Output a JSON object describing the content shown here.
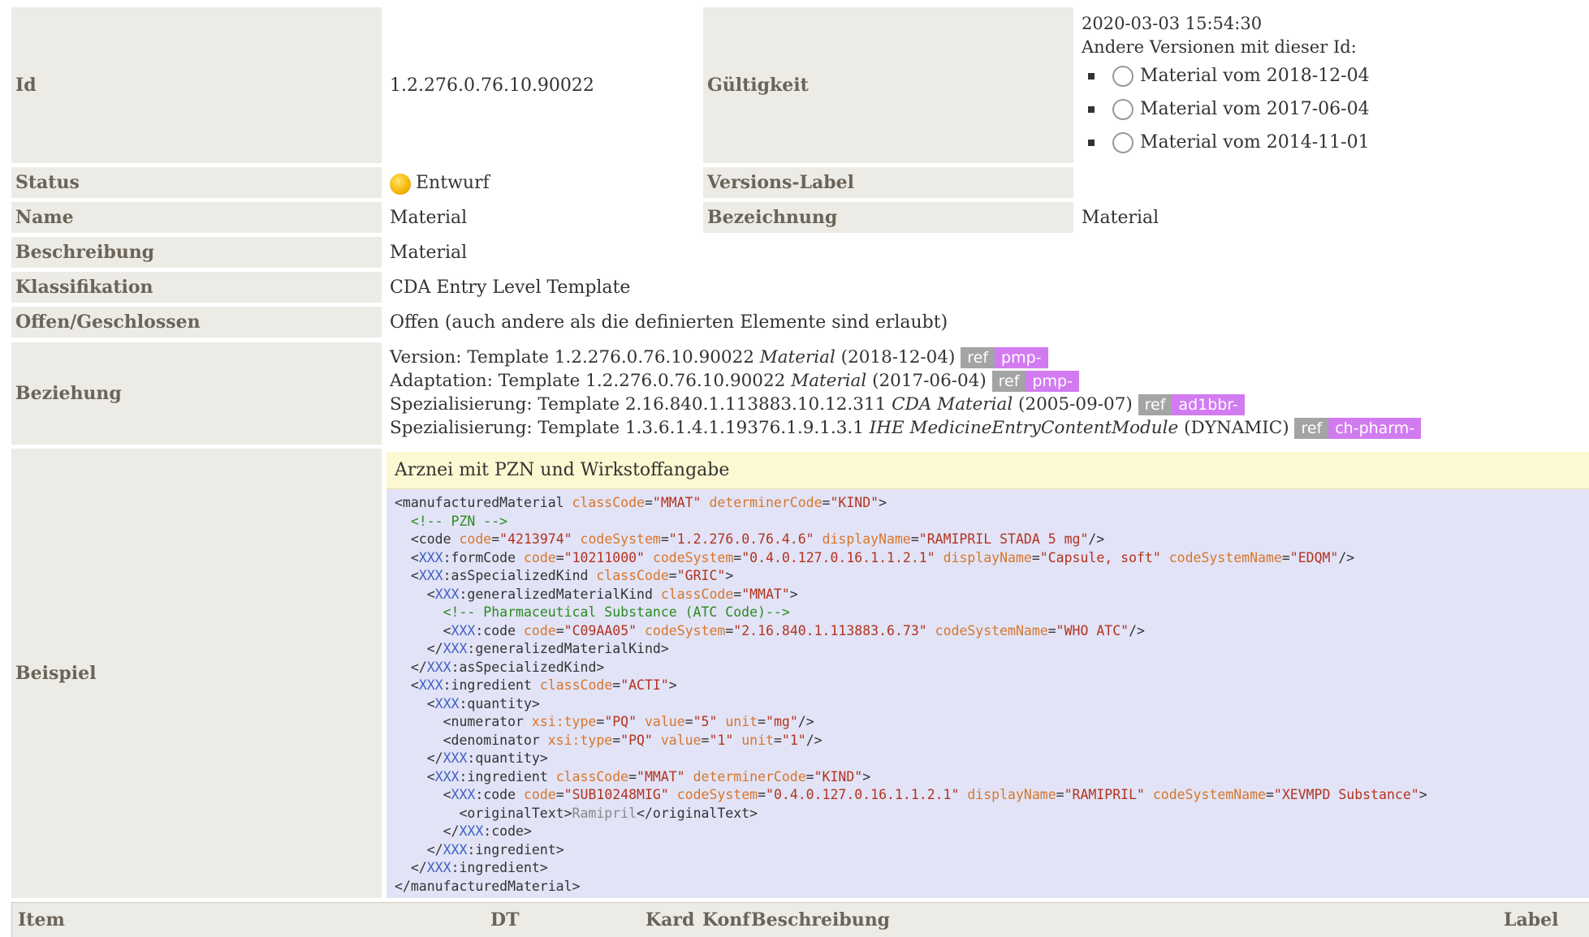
{
  "rows": {
    "id": {
      "label": "Id",
      "value": "1.2.276.0.76.10.90022"
    },
    "validity": {
      "label": "Gültigkeit",
      "date": "2020-03-03 15:54:30",
      "other_versions_label": "Andere Versionen mit dieser Id:",
      "versions": [
        "Material vom 2018-12-04",
        "Material vom 2017-06-04",
        "Material vom 2014-11-01"
      ]
    },
    "status": {
      "label": "Status",
      "value": "Entwurf"
    },
    "version_label": {
      "label": "Versions-Label",
      "value": ""
    },
    "name": {
      "label": "Name",
      "value": "Material"
    },
    "designation": {
      "label": "Bezeichnung",
      "value": "Material"
    },
    "description": {
      "label": "Beschreibung",
      "value": "Material"
    },
    "classification": {
      "label": "Klassifikation",
      "value": "CDA Entry Level Template"
    },
    "open_closed": {
      "label": "Offen/Geschlossen",
      "value": "Offen (auch andere als die definierten Elemente sind erlaubt)"
    },
    "relationship": {
      "label": "Beziehung",
      "items": [
        {
          "prefix": "Version: Template 1.2.276.0.76.10.90022 ",
          "name": "Material",
          "suffix": " (2018-12-04)",
          "ref": "ref",
          "ref_id": "pmp-"
        },
        {
          "prefix": "Adaptation: Template 1.2.276.0.76.10.90022 ",
          "name": "Material",
          "suffix": " (2017-06-04)",
          "ref": "ref",
          "ref_id": "pmp-"
        },
        {
          "prefix": "Spezialisierung: Template 2.16.840.1.113883.10.12.311 ",
          "name": "CDA Material",
          "suffix": " (2005-09-07)",
          "ref": "ref",
          "ref_id": "ad1bbr-"
        },
        {
          "prefix": "Spezialisierung: Template 1.3.6.1.4.1.19376.1.9.1.3.1 ",
          "name": "IHE MedicineEntryContentModule",
          "suffix": " (DYNAMIC)",
          "ref": "ref",
          "ref_id": "ch-pharm-"
        }
      ]
    },
    "example": {
      "label": "Beispiel",
      "title": "Arznei mit PZN und Wirkstoffangabe",
      "code_lines": [
        "<manufacturedMaterial classCode=\"MMAT\" determinerCode=\"KIND\">",
        "  <!-- PZN -->",
        "  <code code=\"4213974\" codeSystem=\"1.2.276.0.76.4.6\" displayName=\"RAMIPRIL STADA 5 mg\"/>",
        "  <XXX:formCode code=\"10211000\" codeSystem=\"0.4.0.127.0.16.1.1.2.1\" displayName=\"Capsule, soft\" codeSystemName=\"EDQM\"/>",
        "  <XXX:asSpecializedKind classCode=\"GRIC\">",
        "    <XXX:generalizedMaterialKind classCode=\"MMAT\">",
        "      <!-- Pharmaceutical Substance (ATC Code)-->",
        "      <XXX:code code=\"C09AA05\" codeSystem=\"2.16.840.1.113883.6.73\" codeSystemName=\"WHO ATC\"/>",
        "    </XXX:generalizedMaterialKind>",
        "  </XXX:asSpecializedKind>",
        "  <XXX:ingredient classCode=\"ACTI\">",
        "    <XXX:quantity>",
        "      <numerator xsi:type=\"PQ\" value=\"5\" unit=\"mg\"/>",
        "      <denominator xsi:type=\"PQ\" value=\"1\" unit=\"1\"/>",
        "    </XXX:quantity>",
        "    <XXX:ingredient classCode=\"MMAT\" determinerCode=\"KIND\">",
        "      <XXX:code code=\"SUB10248MIG\" codeSystem=\"0.4.0.127.0.16.1.1.2.1\" displayName=\"RAMIPRIL\" codeSystemName=\"XEVMPD Substance\">",
        "        <originalText>Ramipril</originalText>",
        "      </XXX:code>",
        "    </XXX:ingredient>",
        "  </XXX:ingredient>",
        "</manufacturedMaterial>"
      ]
    }
  },
  "table_header": {
    "item": "Item",
    "dt": "DT",
    "kard": "Kard",
    "konf": "Konf",
    "beschreibung": "Beschreibung",
    "label": "Label"
  },
  "colors": {
    "label_bg": "#ecebe6",
    "label_text": "#6c6458",
    "example_head_bg": "#fbf8d2",
    "code_bg": "#e2e3f6",
    "ref_grey": "#a4a4a4",
    "ref_purple": "#d27bf1",
    "status_draft": "#f5b400"
  }
}
